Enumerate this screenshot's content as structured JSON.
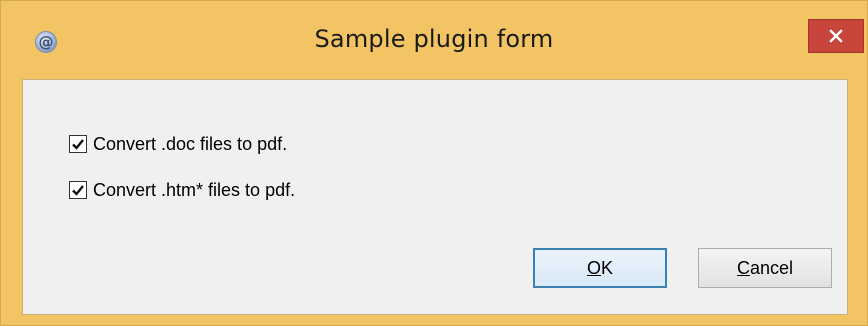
{
  "window": {
    "title": "Sample plugin form",
    "icon": "at-sign-icon",
    "icon_glyph": "@",
    "close_glyph": "close-icon",
    "accent_color": "#f2c463",
    "close_color": "#c7453b"
  },
  "form": {
    "checkboxes": [
      {
        "label": "Convert .doc files to pdf.",
        "checked": true
      },
      {
        "label": "Convert .htm* files to pdf.",
        "checked": true
      }
    ]
  },
  "buttons": {
    "ok": {
      "mnemonic": "O",
      "rest": "K"
    },
    "cancel": {
      "mnemonic": "C",
      "rest": "ancel"
    }
  }
}
